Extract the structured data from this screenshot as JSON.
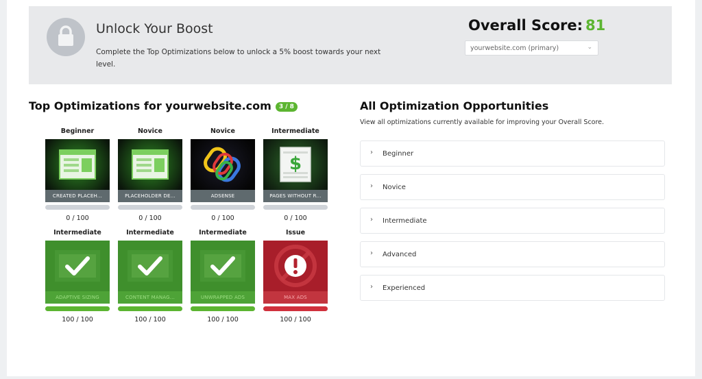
{
  "boost": {
    "title": "Unlock Your Boost",
    "description": "Complete the Top Optimizations below to unlock a 5% boost towards your next level.",
    "icon": "lock-icon"
  },
  "score": {
    "label": "Overall Score:",
    "value": "81",
    "value_color": "#5cb531"
  },
  "site_select": {
    "value": "yourwebsite.com (primary)"
  },
  "top_optimizations": {
    "title": "Top Optimizations for yourwebsite.com",
    "progress": "3 / 8",
    "cards": [
      {
        "level": "Beginner",
        "caption": "CREATED PLACEH...",
        "score": "0 / 100",
        "progress": 0,
        "status": "incomplete",
        "icon": "placeholder-page-icon"
      },
      {
        "level": "Novice",
        "caption": "PLACEHOLDER DE...",
        "score": "0 / 100",
        "progress": 0,
        "status": "incomplete",
        "icon": "placeholder-page-icon"
      },
      {
        "level": "Novice",
        "caption": "ADSENSE",
        "score": "0 / 100",
        "progress": 0,
        "status": "incomplete",
        "icon": "chain-link-icon"
      },
      {
        "level": "Intermediate",
        "caption": "PAGES WITHOUT R...",
        "score": "0 / 100",
        "progress": 0,
        "status": "incomplete",
        "icon": "dollar-page-icon"
      },
      {
        "level": "Intermediate",
        "caption": "ADAPTIVE SIZING",
        "score": "100 / 100",
        "progress": 1,
        "status": "complete",
        "icon": "checkmark-icon"
      },
      {
        "level": "Intermediate",
        "caption": "CONTENT MANAG...",
        "score": "100 / 100",
        "progress": 1,
        "status": "complete",
        "icon": "checkmark-icon"
      },
      {
        "level": "Intermediate",
        "caption": "UNWRAPPED ADS",
        "score": "100 / 100",
        "progress": 1,
        "status": "complete",
        "icon": "checkmark-icon"
      },
      {
        "level": "Issue",
        "caption": "MAX ADS",
        "score": "100 / 100",
        "progress": 1,
        "status": "issue",
        "icon": "alert-icon"
      }
    ]
  },
  "all_optimizations": {
    "title": "All Optimization Opportunities",
    "subtitle": "View all optimizations currently available for improving your Overall Score.",
    "items": [
      "Beginner",
      "Novice",
      "Intermediate",
      "Advanced",
      "Experienced"
    ]
  },
  "colors": {
    "accent_green": "#5cb531",
    "issue_red": "#d0303c",
    "bar_empty": "#cfd3d8"
  }
}
